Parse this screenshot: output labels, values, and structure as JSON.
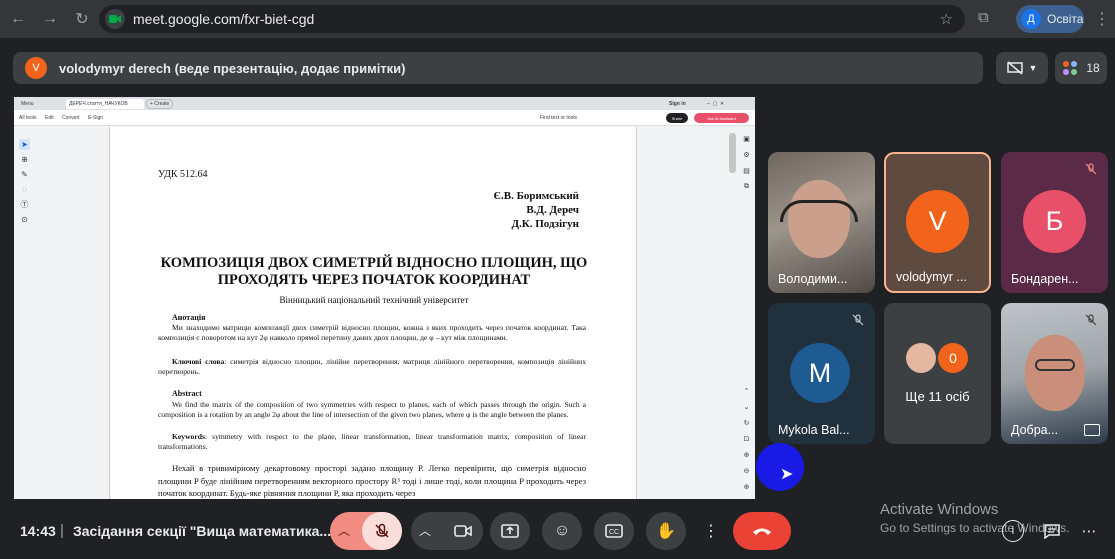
{
  "browser": {
    "url": "meet.google.com/fxr-biet-cgd",
    "profile_initial": "Д",
    "profile_name": "Освіта"
  },
  "banner": {
    "avatar_initial": "V",
    "text": "volodymyr derech (веде презентацію, додає примітки)"
  },
  "people_count": "18",
  "shared_screen": {
    "tabs": [
      "Menu",
      "ДЕРЕЧ.стаття_НАЧУКОВ",
      "+ Create"
    ],
    "signin": "Sign in",
    "menus": [
      "All tools",
      "Edit",
      "Convert",
      "E-Sign"
    ],
    "find_text": "Find text or tools",
    "share_label": "Share",
    "ai_label": "Ask AI Assistant",
    "paper": {
      "udk": "УДК 512.64",
      "authors": [
        "Є.В. Боримський",
        "В.Д. Дереч",
        "Д.К. Подзігун"
      ],
      "title_line1": "КОМПОЗИЦІЯ ДВОХ СИМЕТРІЙ ВІДНОСНО ПЛОЩИН, ЩО",
      "title_line2": "ПРОХОДЯТЬ ЧЕРЕЗ ПОЧАТОК КООРДИНАТ",
      "affiliation": "Вінницький національний технічний університет",
      "annotation_heading": "Анотація",
      "annotation_text": "Ми знаходимо матрицю композиції двох симетрій відносно площин, кожна з яких проходить через початок координат. Така композиція є поворотом на кут 2φ навколо прямої перетину даних двох площин, де φ – кут між площинами.",
      "keywords_heading": "Ключові слова",
      "keywords_text": ": симетрія відносно площин, лінійне перетворення, матриця лінійного перетворення, композиція лінійних перетворень.",
      "abstract_heading": "Abstract",
      "abstract_text": "We find the matrix of the composition of two symmetries with respect to planes, each of which passes through the origin. Such a composition is a rotation by an angle 2φ about the line of intersection of the given two planes, where φ is the angle between the planes.",
      "keywords_en_heading": "Keywords",
      "keywords_en_text": ": symmetry with respect to the plane, linear transformation, linear transformation matrix, composition of linear transformations.",
      "body_text": "Нехай в тривимірному декартовому просторі задано площину P. Легко перевірити, що симетрія відносно площини P буде лінійним перетворенням векторного простору R³ тоді і лише тоді, коли площина P проходить через початок координат. Будь-яке рівняння площини P, яка проходить через"
    }
  },
  "participants": [
    {
      "name": "Володими...",
      "kind": "video"
    },
    {
      "name": "volodymyr ...",
      "initial": "V",
      "color": "#f2631c",
      "kind": "avatar"
    },
    {
      "name": "Бондарен...",
      "initial": "Б",
      "color": "#e8506a",
      "kind": "avatar"
    },
    {
      "name": "Mykola Bal...",
      "initial": "M",
      "color": "#1e5b93",
      "kind": "avatar"
    },
    {
      "name": "Ще 11 осіб",
      "badge": "0",
      "kind": "group"
    },
    {
      "name": "Добра...",
      "kind": "video"
    }
  ],
  "meeting": {
    "time": "14:43",
    "separator": "|",
    "title": "Засідання секції \"Вища математика..."
  },
  "watermark": {
    "title": "Activate Windows",
    "subtitle": "Go to Settings to activate Windows."
  },
  "colors": {
    "end_call": "#ea4335",
    "mic_off": "#f9dedc",
    "presenter": "#f2631c"
  }
}
